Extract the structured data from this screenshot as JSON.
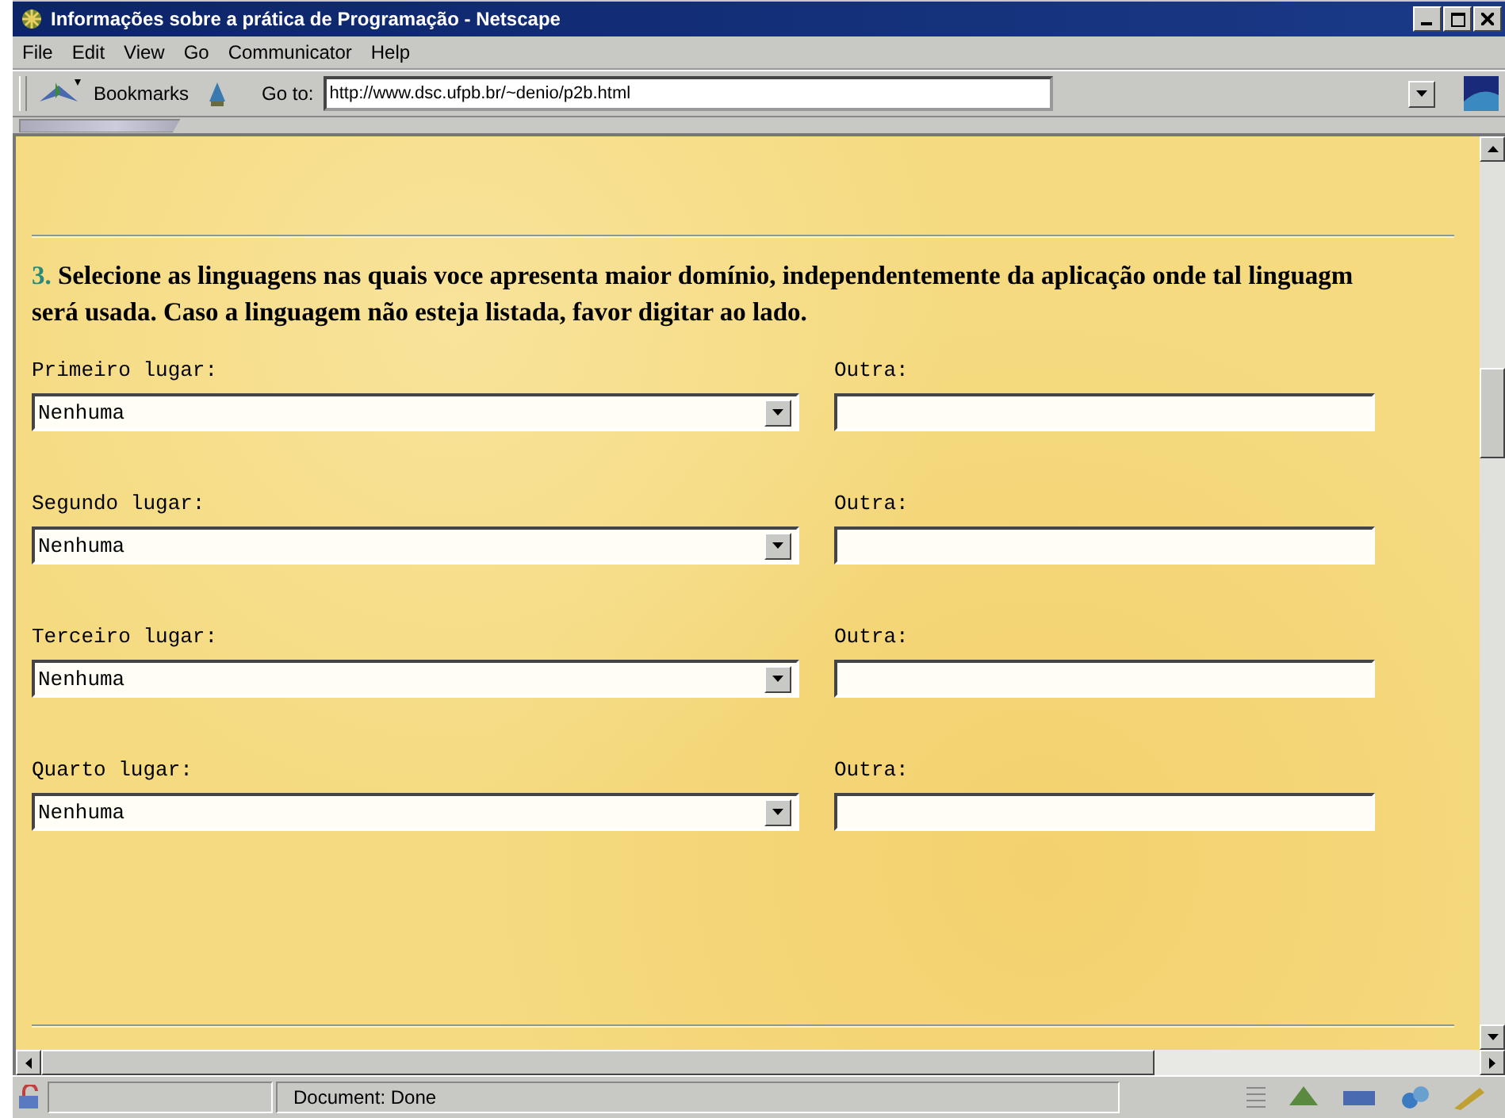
{
  "window": {
    "title": "Informações sobre a prática de Programação - Netscape"
  },
  "menu": [
    "File",
    "Edit",
    "View",
    "Go",
    "Communicator",
    "Help"
  ],
  "toolbar": {
    "bookmarks": "Bookmarks",
    "goto_label": "Go to:",
    "url": "http://www.dsc.ufpb.br/~denio/p2b.html"
  },
  "question": {
    "number": "3.",
    "text": "Selecione as linguagens nas quais voce apresenta maior domínio, independentemente da aplicação onde tal linguagm será usada. Caso a linguagem não esteja listada, favor digitar ao lado."
  },
  "rows": [
    {
      "label": "Primeiro lugar:",
      "value": "Nenhuma",
      "other_label": "Outra:"
    },
    {
      "label": "Segundo lugar:",
      "value": "Nenhuma",
      "other_label": "Outra:"
    },
    {
      "label": "Terceiro lugar:",
      "value": "Nenhuma",
      "other_label": "Outra:"
    },
    {
      "label": "Quarto lugar:",
      "value": "Nenhuma",
      "other_label": "Outra:"
    }
  ],
  "status_bar": {
    "text": "Document: Done"
  }
}
